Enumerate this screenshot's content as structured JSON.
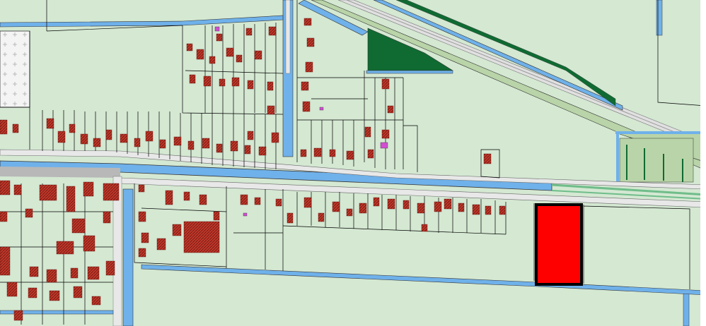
{
  "map": {
    "colors": {
      "land": "#d4e8d2",
      "water": "#6fb1ea",
      "road": "#dcdcdc",
      "buildings": "#c0392b",
      "green_strip": "#0f6b32",
      "highlighted_parcel": "#ff0000",
      "parcel_lines": "#000000"
    },
    "highlighted_parcel": {
      "label": "",
      "fill": "#ff0000",
      "stroke": "#000000"
    },
    "legend": []
  }
}
